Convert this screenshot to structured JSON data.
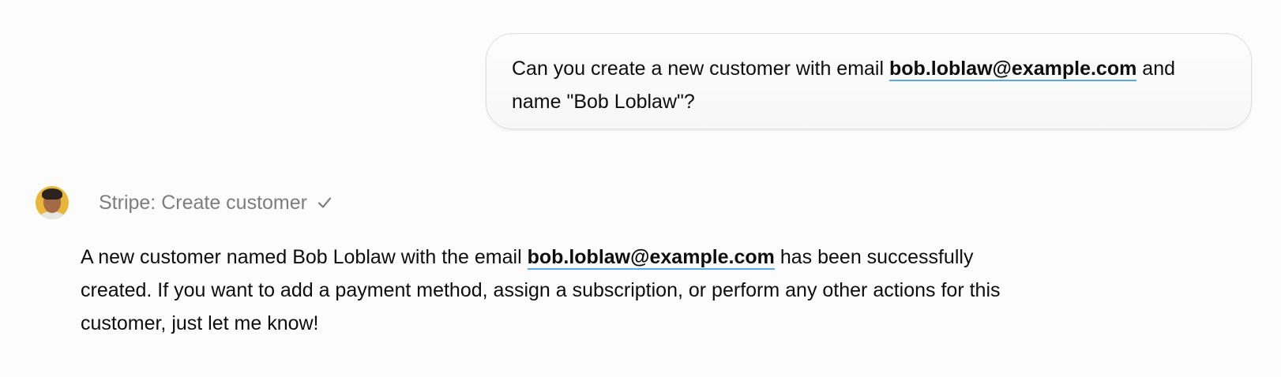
{
  "user_message": {
    "text_before": "Can you create a new customer with email ",
    "email": "bob.loblaw@example.com",
    "text_after": " and name \"Bob Loblaw\"?"
  },
  "assistant": {
    "avatar_icon": "user-avatar",
    "tool_call": {
      "label": "Stripe: Create customer",
      "status_icon": "check-icon"
    },
    "response": {
      "text_before": "A new customer named Bob Loblaw with the email ",
      "email": "bob.loblaw@example.com",
      "text_after": " has been successfully created. If you want to add a payment method, assign a subscription, or perform any other actions for this customer, just let me know!"
    }
  },
  "colors": {
    "background": "#fcfcfc",
    "link_underline": "#5aa9e6",
    "muted_text": "#7d7d7d",
    "avatar_bg": "#e9b53a"
  }
}
